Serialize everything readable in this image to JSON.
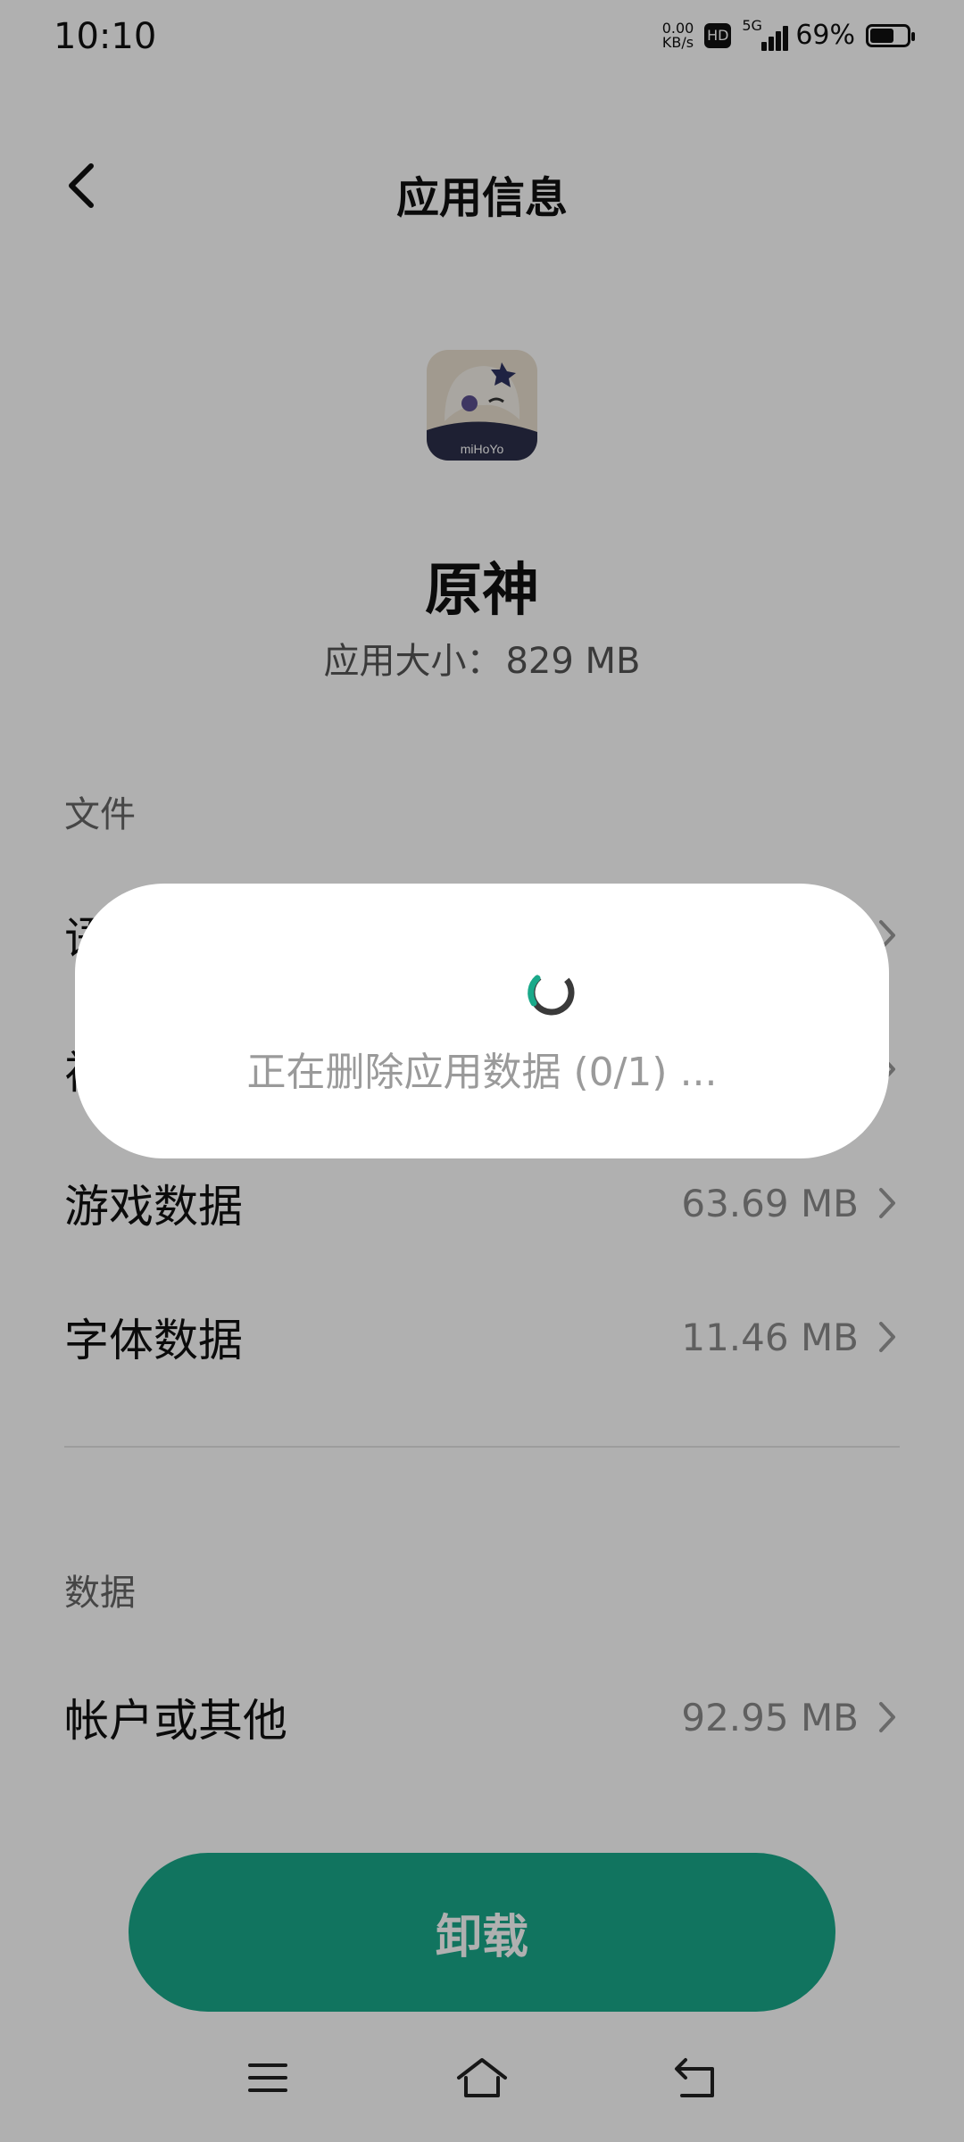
{
  "status_bar": {
    "time": "10:10",
    "net_speed_value": "0.00",
    "net_speed_unit": "KB/s",
    "hd_badge": "HD",
    "network_type": "5G",
    "battery_percent": "69%",
    "battery_level": 0.69
  },
  "header": {
    "back_icon": "chevron-left-icon",
    "title": "应用信息"
  },
  "app": {
    "name": "原神",
    "size_label": "应用大小：",
    "size_value": "829 MB",
    "icon_text": "miHoYo"
  },
  "files_section": {
    "title": "文件",
    "rows": [
      {
        "label": "语",
        "value": "",
        "icon": "chevron-right-icon"
      },
      {
        "label": "视",
        "value": "",
        "icon": "chevron-right-icon"
      },
      {
        "label": "游戏数据",
        "value": "63.69 MB",
        "icon": "chevron-right-icon"
      },
      {
        "label": "字体数据",
        "value": "11.46 MB",
        "icon": "chevron-right-icon"
      }
    ]
  },
  "data_section": {
    "title": "数据",
    "rows": [
      {
        "label": "帐户或其他",
        "value": "92.95 MB",
        "icon": "chevron-right-icon"
      }
    ]
  },
  "actions": {
    "uninstall_label": "卸载"
  },
  "dialog": {
    "message": "正在删除应用数据 (0/1) ..."
  },
  "nav_bar": {
    "menu_icon": "menu-icon",
    "home_icon": "home-icon",
    "back_icon": "back-icon"
  },
  "colors": {
    "accent": "#1aa98a",
    "scrim": "rgba(0,0,0,0.31)",
    "dialog_bg": "#ffffff"
  }
}
